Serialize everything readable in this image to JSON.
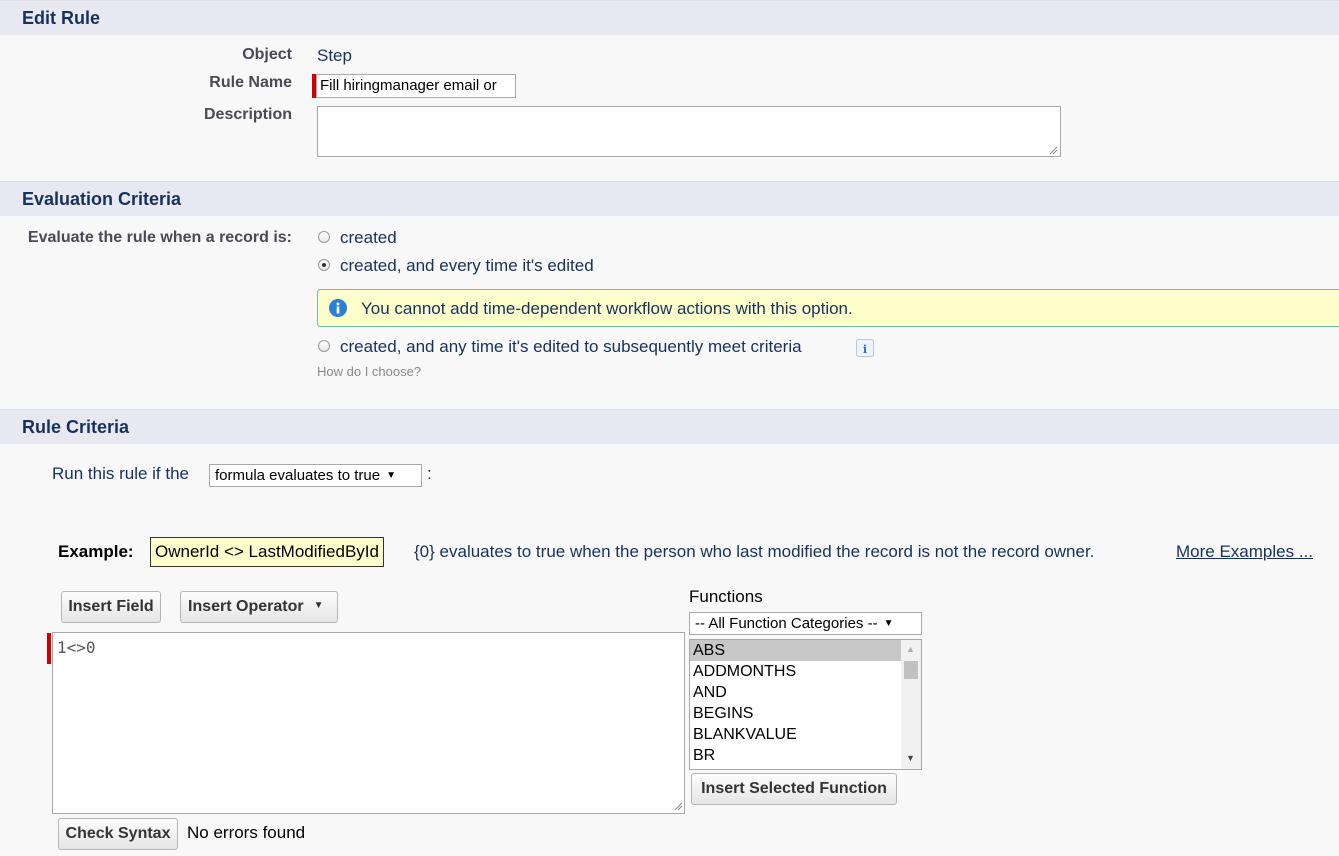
{
  "edit_rule": {
    "header": "Edit Rule",
    "object_label": "Object",
    "object_value": "Step",
    "rule_name_label": "Rule Name",
    "rule_name_value": "Fill hiringmanager email or",
    "description_label": "Description",
    "description_value": ""
  },
  "evaluation": {
    "header": "Evaluation Criteria",
    "label": "Evaluate the rule when a record is:",
    "options": [
      {
        "label": "created",
        "checked": false
      },
      {
        "label": "created, and every time it's edited",
        "checked": true
      },
      {
        "label": "created, and any time it's edited to subsequently meet criteria",
        "checked": false
      }
    ],
    "info_message": "You cannot add time-dependent workflow actions with this option.",
    "help_link": "How do I choose?"
  },
  "rule_criteria": {
    "header": "Rule Criteria",
    "run_prefix": "Run this rule if the",
    "run_select": "formula evaluates to true",
    "run_suffix": ":",
    "example_label": "Example:",
    "example_code": "OwnerId <> LastModifiedById",
    "example_text": "{0} evaluates to true when the person who last modified the record is not the record owner.",
    "more_examples": "More Examples ...",
    "insert_field": "Insert Field",
    "insert_operator": "Insert Operator",
    "formula_value": "1<>0",
    "functions_label": "Functions",
    "function_category": "-- All Function Categories --",
    "functions": [
      "ABS",
      "ADDMONTHS",
      "AND",
      "BEGINS",
      "BLANKVALUE",
      "BR"
    ],
    "insert_selected_function": "Insert Selected Function",
    "check_syntax": "Check Syntax",
    "syntax_status": "No errors found"
  },
  "colors": {
    "header_bg": "#e8e8f0",
    "required": "#cc0000",
    "info_bg": "#ffffcc",
    "info_border": "#7ab8b0",
    "info_icon": "#2c7fd6"
  }
}
